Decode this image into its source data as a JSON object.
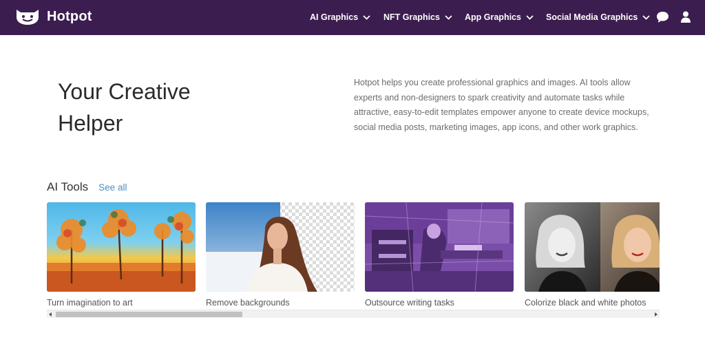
{
  "brand": {
    "name": "Hotpot",
    "logo_icon": "smiling-pot-icon"
  },
  "nav": {
    "items": [
      {
        "label": "AI Graphics",
        "icon": "chevron-down-icon"
      },
      {
        "label": "NFT Graphics",
        "icon": "chevron-down-icon"
      },
      {
        "label": "App Graphics",
        "icon": "chevron-down-icon"
      },
      {
        "label": "Social Media Graphics",
        "icon": "chevron-down-icon"
      }
    ],
    "actions": [
      {
        "icon": "chat-icon"
      },
      {
        "icon": "user-icon"
      }
    ]
  },
  "hero": {
    "title_line1": "Your Creative",
    "title_line2": "Helper",
    "description": "Hotpot helps you create professional graphics and images. AI tools allow experts and non-designers to spark creativity and automate tasks while attractive, easy-to-edit templates empower anyone to create device mockups, social media posts, marketing images, app icons, and other work graphics."
  },
  "ai_tools": {
    "title": "AI Tools",
    "see_all": "See all",
    "cards": [
      {
        "caption": "Turn imagination to art"
      },
      {
        "caption": "Remove backgrounds"
      },
      {
        "caption": "Outsource writing tasks"
      },
      {
        "caption": "Colorize black and white photos"
      }
    ]
  },
  "colors": {
    "header_bg": "#3b1d4f",
    "link": "#4a90c8"
  }
}
